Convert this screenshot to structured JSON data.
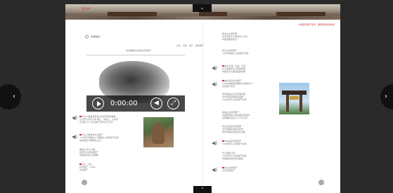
{
  "navigation": {
    "prev_label": "‹",
    "next_label": "›",
    "dropdown_label": "⌄",
    "up_label": "⌃"
  },
  "banner": {
    "title": "丽江古城",
    "right_note": "中国世界遗产名录 · 国家旅游资源丰富"
  },
  "left_page": {
    "section_title": "世界遗产",
    "meta1": "文化 · 自然 · 遗产 · 世界遗产",
    "meta2": "联合国教科文组织世界遗产",
    "video": {
      "time": "0:00:00"
    },
    "items": [
      {
        "lines": [
          "乐山大佛是世界最大的石刻弥勒佛像",
          "位于四川省乐山市,岷江、青衣江、大渡河",
          "汇流处,高71米,始凿于唐代开元元年"
        ]
      },
      {
        "lines": [
          "乐山大佛世界文化遗产",
          "1996年与峨眉山一起被列入世界遗产名录",
          "是中国四大佛教名山之一"
        ]
      },
      {
        "lines": [
          "峨眉山-乐山大佛",
          "自然与文化双重遗产",
          "中国现存最大的佛像"
        ]
      },
      {
        "lines": [
          "乐山 · 四川",
          "世界遗产 · 1996",
          "文化遗产"
        ]
      }
    ]
  },
  "right_page": {
    "items": [
      {
        "lines": [
          "武当山古建筑群",
          "位于湖北省十堰市丹江口市",
          "中国道教圣地之一"
        ]
      },
      {
        "lines": [
          "武当山世界遗产",
          "1994年被列入世界遗产名录"
        ]
      },
      {
        "lines": [
          "曲阜孔庙、孔林、孔府",
          "孔子故居和孔氏家族墓地",
          "中国古代大型祠庙建筑群"
        ]
      },
      {
        "lines": [
          "曲阜世界文化遗产",
          "1994年被联合国教科文组织列入",
          "世界遗产名录"
        ]
      },
      {
        "lines": [
          "承德避暑山庄及周围寺庙",
          "清代皇家园林和寺庙群",
          "1994年列入世界遗产名录"
        ]
      },
      {
        "lines": [
          "避暑山庄世界遗产",
          "中国现存最大的古典皇家园林",
          "建筑面积五百六十万平方米"
        ]
      },
      {
        "lines": [
          "布达拉宫历史建筑群",
          "位于西藏自治区拉萨市",
          "世界海拔最高的古代宫殿"
        ]
      },
      {
        "lines": [
          "布达拉宫世界遗产",
          "1994年列入世界遗产名录"
        ]
      },
      {
        "lines": [
          "庐山国家公园",
          "1996年列入世界遗产名录",
          "中国著名的风景名胜区"
        ]
      },
      {
        "lines": [
          "庐山世界遗产",
          "文化景观遗产"
        ]
      }
    ]
  },
  "colors": {
    "accent": "#cc3333",
    "background": "#2a2a2a",
    "page": "#ffffff"
  }
}
